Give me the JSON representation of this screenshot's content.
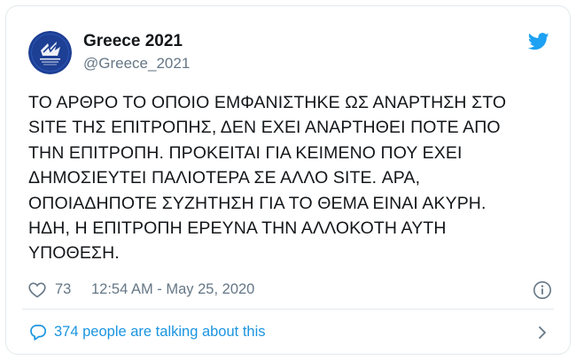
{
  "tweet": {
    "author": {
      "display_name": "Greece 2021",
      "handle": "@Greece_2021"
    },
    "lines": [
      "ΤΟ ΑΡΘΡΟ ΤΟ ΟΠΟΙΟ ΕΜΦΑΝΙΣΤΗΚΕ ΩΣ ΑΝΑΡΤΗΣΗ ΣΤΟ",
      "SITE ΤΗΣ ΕΠΙΤΡΟΠΗΣ, ΔΕΝ ΕΧΕΙ ΑΝΑΡΤΗΘΕΙ ΠΟΤΕ ΑΠΟ",
      "ΤΗΝ ΕΠΙΤΡΟΠΗ. ΠΡΟΚΕΙΤΑΙ ΓΙΑ ΚΕΙΜΕΝΟ ΠΟΥ ΕΧΕΙ",
      "ΔΗΜΟΣΙΕΥΤΕΙ ΠΑΛΙΟΤΕΡΑ ΣΕ ΑΛΛΟ SITE. ΑΡΑ,",
      "ΟΠΟΙΑΔΗΠΟΤΕ ΣΥΖΗΤΗΣΗ ΓΙΑ ΤΟ ΘΕΜΑ ΕΙΝΑΙ ΑΚΥΡΗ.",
      "ΗΔΗ, Η ΕΠΙΤΡΟΠΗ ΕΡΕΥΝΑ ΤΗΝ ΑΛΛΟΚΟΤΗ ΑΥΤΗ",
      "ΥΠΟΘΕΣΗ."
    ],
    "likes": "73",
    "timestamp": "12:54 AM - May 25, 2020",
    "talking": "374 people are talking about this"
  },
  "icons": {
    "brand": "twitter-bird-icon",
    "like": "heart-icon",
    "info": "info-icon",
    "talk": "speech-bubble-icon",
    "chevron": "chevron-right-icon"
  },
  "colors": {
    "twitter_blue": "#1da1f2",
    "link_blue": "#1b95e0",
    "muted_text": "#657786",
    "avatar_navy": "#1d3f94"
  }
}
